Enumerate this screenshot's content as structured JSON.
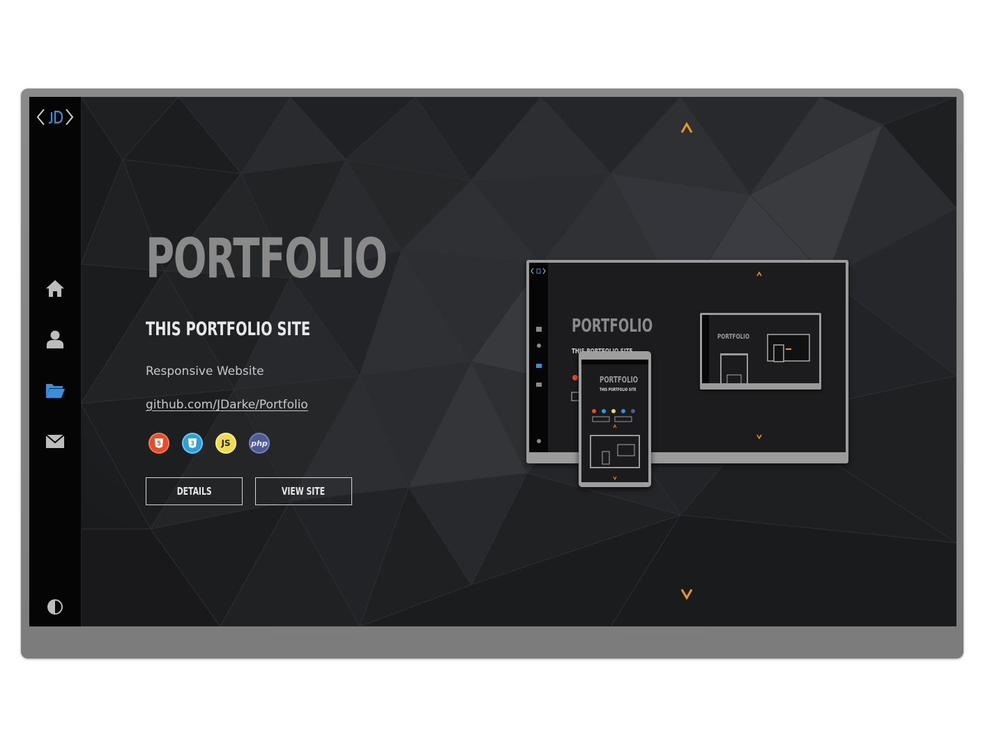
{
  "sidebar": {
    "logo": "jd-logo-icon",
    "items": [
      {
        "name": "home",
        "icon": "home-icon",
        "active": false
      },
      {
        "name": "about",
        "icon": "user-icon",
        "active": false
      },
      {
        "name": "portfolio",
        "icon": "folder-icon",
        "active": true
      },
      {
        "name": "contact",
        "icon": "mail-icon",
        "active": false
      }
    ],
    "theme_toggle": "contrast-icon"
  },
  "main": {
    "section_title": "PORTFOLIO",
    "project_title": "THIS PORTFOLIO SITE",
    "subtitle": "Responsive Website",
    "link": "github.com/JDarke/Portfolio",
    "technologies": [
      {
        "name": "html5-icon",
        "color": "#e44d26",
        "label": "5"
      },
      {
        "name": "css3-icon",
        "color": "#2c9fd8",
        "label": "3"
      },
      {
        "name": "javascript-icon",
        "color": "#f0db4f",
        "label": "JS"
      },
      {
        "name": "php-icon",
        "color": "#4f5b93",
        "label": "php"
      }
    ],
    "buttons": {
      "details": "DETAILS",
      "view_site": "VIEW SITE"
    }
  },
  "preview": {
    "title": "PORTFOLIO",
    "subtitle": "THIS PORTFOLIO SITE"
  },
  "colors": {
    "accent_orange": "#f0961e",
    "accent_blue": "#3a8fd8",
    "background": "#1d1e20",
    "sidebar": "#050505"
  }
}
